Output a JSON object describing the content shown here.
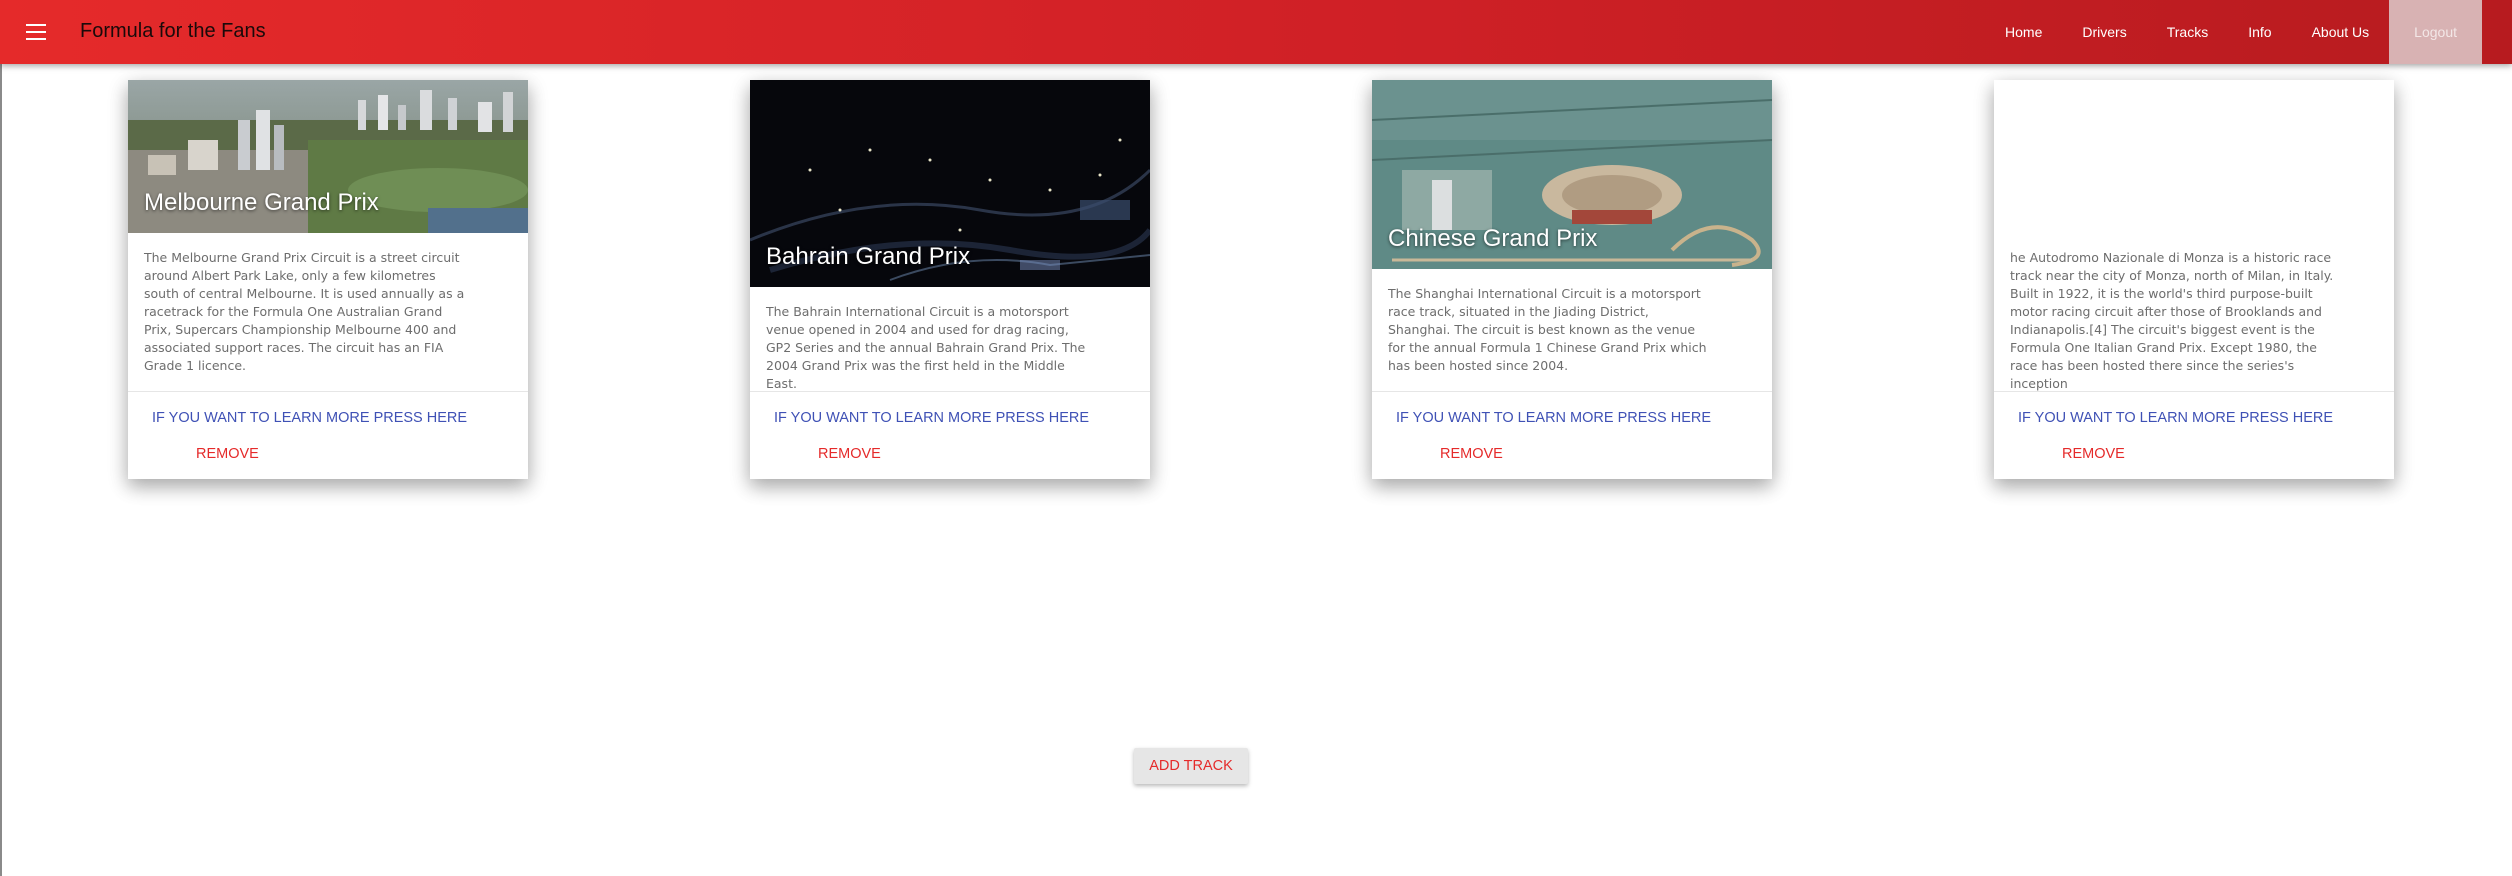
{
  "app": {
    "title": "Formula for the Fans"
  },
  "nav": {
    "home": "Home",
    "drivers": "Drivers",
    "tracks": "Tracks",
    "info": "Info",
    "about": "About Us",
    "logout": "Logout"
  },
  "cards": [
    {
      "title": "Melbourne Grand Prix",
      "text": "The Melbourne Grand Prix Circuit is a street circuit around Albert Park Lake, only a few kilometres south of central Melbourne. It is used annually as a racetrack for the Formula One Australian Grand Prix, Supercars Championship Melbourne 400 and associated support races. The circuit has an FIA Grade 1 licence.",
      "learn_more": "IF YOU WANT TO LEARN MORE PRESS HERE",
      "remove": "REMOVE"
    },
    {
      "title": "Bahrain Grand Prix",
      "text": "The Bahrain International Circuit is a motorsport venue opened in 2004 and used for drag racing, GP2 Series and the annual Bahrain Grand Prix. The 2004 Grand Prix was the first held in the Middle East.",
      "learn_more": "IF YOU WANT TO LEARN MORE PRESS HERE",
      "remove": "REMOVE"
    },
    {
      "title": "Chinese Grand Prix",
      "text": "The Shanghai International Circuit is a motorsport race track, situated in the Jiading District, Shanghai. The circuit is best known as the venue for the annual Formula 1 Chinese Grand Prix which has been hosted since 2004.",
      "learn_more": "IF YOU WANT TO LEARN MORE PRESS HERE",
      "remove": "REMOVE"
    },
    {
      "title": "",
      "text": "he Autodromo Nazionale di Monza is a historic race track near the city of Monza, north of Milan, in Italy. Built in 1922, it is the world's third purpose-built motor racing circuit after those of Brooklands and Indianapolis.[4] The circuit's biggest event is the Formula One Italian Grand Prix. Except 1980, the race has been hosted there since the series's inception",
      "learn_more": "IF YOU WANT TO LEARN MORE PRESS HERE",
      "remove": "REMOVE"
    }
  ],
  "add_track": "ADD TRACK",
  "colors": {
    "primary": "#d42127",
    "link": "#3f51b5",
    "accent": "#e52a2a"
  }
}
